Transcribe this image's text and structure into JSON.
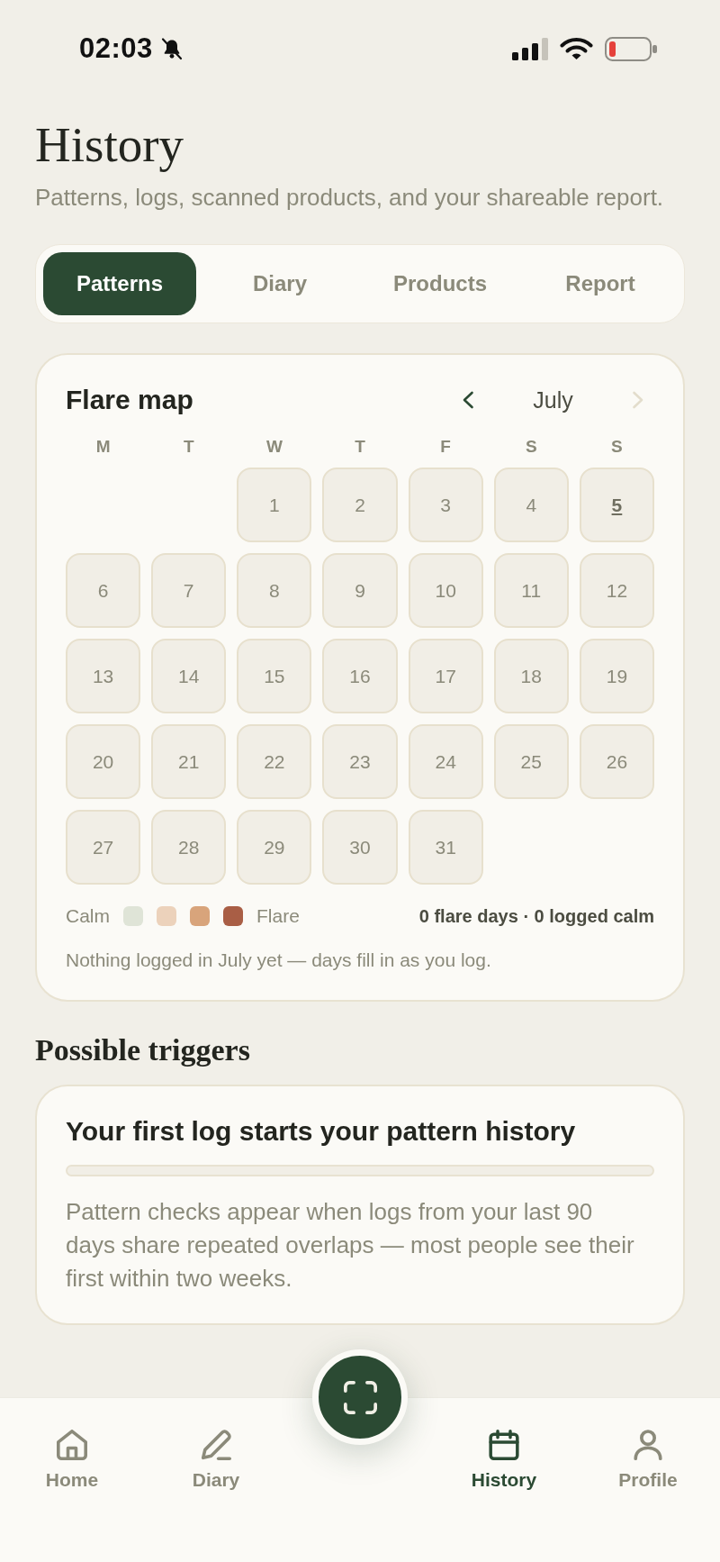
{
  "status_bar": {
    "time": "02:03"
  },
  "header": {
    "title": "History",
    "subtitle": "Patterns, logs, scanned products, and your shareable report."
  },
  "tabs": [
    {
      "label": "Patterns",
      "selected": true
    },
    {
      "label": "Diary",
      "selected": false
    },
    {
      "label": "Products",
      "selected": false
    },
    {
      "label": "Report",
      "selected": false
    }
  ],
  "flare_map": {
    "title": "Flare map",
    "month": "July",
    "prev": {
      "disabled": false
    },
    "next": {
      "disabled": true
    },
    "weekdays": [
      "M",
      "T",
      "W",
      "T",
      "F",
      "S",
      "S"
    ],
    "weeks": [
      [
        {
          "kind": "blank"
        },
        {
          "kind": "blank"
        },
        {
          "kind": "day",
          "day": "1",
          "today": false
        },
        {
          "kind": "day",
          "day": "2",
          "today": false
        },
        {
          "kind": "day",
          "day": "3",
          "today": false
        },
        {
          "kind": "day",
          "day": "4",
          "today": false
        },
        {
          "kind": "day",
          "day": "5",
          "today": true
        }
      ],
      [
        {
          "kind": "day",
          "day": "6",
          "today": false
        },
        {
          "kind": "day",
          "day": "7",
          "today": false
        },
        {
          "kind": "day",
          "day": "8",
          "today": false
        },
        {
          "kind": "day",
          "day": "9",
          "today": false
        },
        {
          "kind": "day",
          "day": "10",
          "today": false
        },
        {
          "kind": "day",
          "day": "11",
          "today": false
        },
        {
          "kind": "day",
          "day": "12",
          "today": false
        }
      ],
      [
        {
          "kind": "day",
          "day": "13",
          "today": false
        },
        {
          "kind": "day",
          "day": "14",
          "today": false
        },
        {
          "kind": "day",
          "day": "15",
          "today": false
        },
        {
          "kind": "day",
          "day": "16",
          "today": false
        },
        {
          "kind": "day",
          "day": "17",
          "today": false
        },
        {
          "kind": "day",
          "day": "18",
          "today": false
        },
        {
          "kind": "day",
          "day": "19",
          "today": false
        }
      ],
      [
        {
          "kind": "day",
          "day": "20",
          "today": false
        },
        {
          "kind": "day",
          "day": "21",
          "today": false
        },
        {
          "kind": "day",
          "day": "22",
          "today": false
        },
        {
          "kind": "day",
          "day": "23",
          "today": false
        },
        {
          "kind": "day",
          "day": "24",
          "today": false
        },
        {
          "kind": "day",
          "day": "25",
          "today": false
        },
        {
          "kind": "day",
          "day": "26",
          "today": false
        }
      ],
      [
        {
          "kind": "day",
          "day": "27",
          "today": false
        },
        {
          "kind": "day",
          "day": "28",
          "today": false
        },
        {
          "kind": "day",
          "day": "29",
          "today": false
        },
        {
          "kind": "day",
          "day": "30",
          "today": false
        },
        {
          "kind": "day",
          "day": "31",
          "today": false
        }
      ]
    ],
    "legend": {
      "start_label": "Calm",
      "swatches": [
        {
          "color": "#dfe4d7"
        },
        {
          "color": "#ecd2bb"
        },
        {
          "color": "#d8a47b"
        },
        {
          "color": "#a95e45"
        }
      ],
      "end_label": "Flare"
    },
    "summary": "0 flare days · 0 logged calm",
    "note": "Nothing logged in July yet — days fill in as you log."
  },
  "triggers": {
    "heading": "Possible triggers",
    "card": {
      "title": "Your first log starts your pattern history",
      "body": "Pattern checks appear when logs from your last 90 days share repeated overlaps — most people see their first within two weeks."
    }
  },
  "bottom_nav": {
    "items": [
      {
        "label": "Home",
        "selected": false
      },
      {
        "label": "Diary",
        "selected": false
      },
      {
        "label": "History",
        "selected": true
      },
      {
        "label": "Profile",
        "selected": false
      }
    ]
  }
}
